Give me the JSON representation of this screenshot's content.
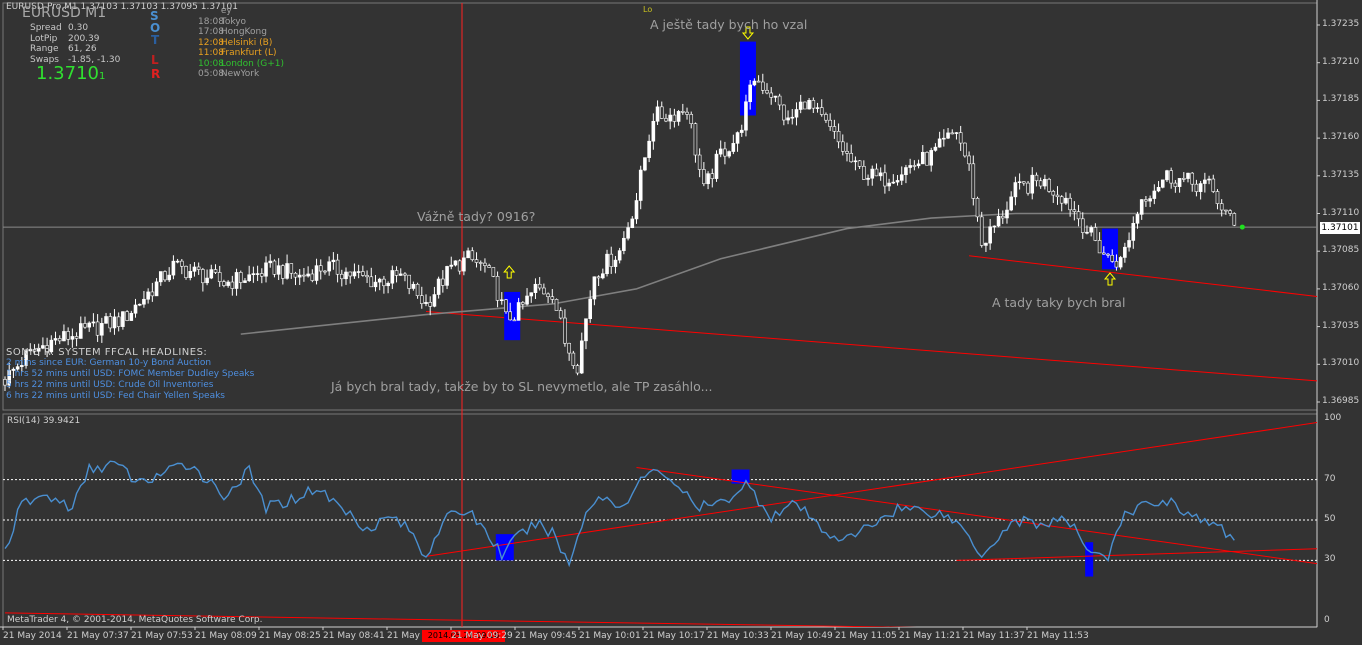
{
  "window": {
    "title": "EURUSD-Pro,M1  1.37103 1.37103 1.37095 1.37101",
    "symbol_big": "EURUSD    M1",
    "bg": "#333333"
  },
  "info_panel": {
    "rows": [
      {
        "label": "Spread",
        "value": "0.30"
      },
      {
        "label": "LotPip",
        "value": "200.39"
      },
      {
        "label": "Range",
        "value": "61, 26"
      },
      {
        "label": "Swaps",
        "value": "-1.85, -1.30"
      }
    ],
    "price": "1.3710",
    "price_digit": "1",
    "icons": [
      "S",
      "O",
      "T",
      "L",
      "R"
    ]
  },
  "sessions": [
    {
      "time": "",
      "name": "ey",
      "color": "#a0a0a0"
    },
    {
      "time": "18:08",
      "name": "Tokyo",
      "color": "#a0a0a0"
    },
    {
      "time": "17:08",
      "name": "HongKong",
      "color": "#a0a0a0"
    },
    {
      "time": "12:08",
      "name": "Helsinki  (B)",
      "color": "#e8a020"
    },
    {
      "time": "11:08",
      "name": "Frankfurt  (L)",
      "color": "#e8a020"
    },
    {
      "time": "10:08",
      "name": "London  (G+1)",
      "color": "#30c030"
    },
    {
      "time": "05:08",
      "name": "NewYork",
      "color": "#a0a0a0"
    }
  ],
  "news": {
    "headline": "SONIC R. SYSTEM  FFCAL HEADLINES:",
    "items": [
      "2 mins since EUR: German 10-y Bond Auction",
      "1 hrs 52 mins until USD: FOMC Member Dudley Speaks",
      "5 hrs 22 mins until USD: Crude Oil Inventories",
      "6 hrs 22 mins until USD: Fed Chair Yellen Speaks"
    ]
  },
  "annotations": {
    "top": "A ještě tady bych ho vzal",
    "mid": "Vážně tady? 0916?",
    "right": "A tady taky bych bral",
    "bottom": "Já bych bral tady, takže by to SL nevymetlo, ale TP zasáhlo...",
    "lo": "Lo"
  },
  "footer": {
    "copyright": "MetaTrader 4, © 2001-2014, MetaQuotes Software Corp.",
    "cursor_time": "2014.05.21 09:16",
    "current_price": "1.37101"
  },
  "colors": {
    "candle_up": "#ffffff",
    "candle_down": "#333333",
    "ma": "#7f7f7f",
    "trend": "#ff0000",
    "rsi": "#4a8fd0",
    "signal_box": "#0000ff",
    "arrow": "#ffff00",
    "axis": "#d0d0d0"
  },
  "chart_data": [
    {
      "type": "candlestick",
      "title": "EURUSD-Pro,M1",
      "y_tick_labels": [
        "1.37235",
        "1.37210",
        "1.37185",
        "1.37160",
        "1.37135",
        "1.37110",
        "1.37085",
        "1.37060",
        "1.37035",
        "1.37010",
        "1.36985"
      ],
      "ylim": [
        1.3698,
        1.3724
      ],
      "x_tick_labels": [
        "21 May 2014",
        "21 May 07:37",
        "21 May 07:53",
        "21 May 08:09",
        "21 May 08:25",
        "21 May 08:41",
        "21 May",
        "21 May 09:29",
        "21 May 09:45",
        "21 May 10:01",
        "21 May 10:17",
        "21 May 10:33",
        "21 May 10:49",
        "21 May 11:05",
        "21 May 11:21",
        "21 May 11:37",
        "21 May 11:53"
      ],
      "anchors": [
        {
          "bar": 0,
          "price": 1.37
        },
        {
          "bar": 5,
          "price": 1.37015
        },
        {
          "bar": 10,
          "price": 1.37024
        },
        {
          "bar": 20,
          "price": 1.37033
        },
        {
          "bar": 28,
          "price": 1.3704
        },
        {
          "bar": 35,
          "price": 1.3706
        },
        {
          "bar": 40,
          "price": 1.37075
        },
        {
          "bar": 46,
          "price": 1.3707
        },
        {
          "bar": 52,
          "price": 1.37064
        },
        {
          "bar": 58,
          "price": 1.37068
        },
        {
          "bar": 64,
          "price": 1.37074
        },
        {
          "bar": 70,
          "price": 1.37068
        },
        {
          "bar": 76,
          "price": 1.37075
        },
        {
          "bar": 82,
          "price": 1.3707
        },
        {
          "bar": 88,
          "price": 1.37065
        },
        {
          "bar": 94,
          "price": 1.37068
        },
        {
          "bar": 100,
          "price": 1.3705
        },
        {
          "bar": 106,
          "price": 1.37074
        },
        {
          "bar": 110,
          "price": 1.3708
        },
        {
          "bar": 114,
          "price": 1.37074
        },
        {
          "bar": 117,
          "price": 1.37058
        },
        {
          "bar": 119,
          "price": 1.3704
        },
        {
          "bar": 122,
          "price": 1.37045
        },
        {
          "bar": 126,
          "price": 1.3706
        },
        {
          "bar": 130,
          "price": 1.37058
        },
        {
          "bar": 133,
          "price": 1.37025
        },
        {
          "bar": 136,
          "price": 1.3701
        },
        {
          "bar": 140,
          "price": 1.3707
        },
        {
          "bar": 146,
          "price": 1.37085
        },
        {
          "bar": 150,
          "price": 1.3712
        },
        {
          "bar": 154,
          "price": 1.37175
        },
        {
          "bar": 158,
          "price": 1.37175
        },
        {
          "bar": 162,
          "price": 1.3718
        },
        {
          "bar": 166,
          "price": 1.37125
        },
        {
          "bar": 170,
          "price": 1.3715
        },
        {
          "bar": 174,
          "price": 1.3716
        },
        {
          "bar": 178,
          "price": 1.372
        },
        {
          "bar": 182,
          "price": 1.3719
        },
        {
          "bar": 186,
          "price": 1.3717
        },
        {
          "bar": 190,
          "price": 1.37185
        },
        {
          "bar": 196,
          "price": 1.37165
        },
        {
          "bar": 202,
          "price": 1.3714
        },
        {
          "bar": 208,
          "price": 1.37132
        },
        {
          "bar": 214,
          "price": 1.3714
        },
        {
          "bar": 220,
          "price": 1.37148
        },
        {
          "bar": 226,
          "price": 1.37165
        },
        {
          "bar": 229,
          "price": 1.3714
        },
        {
          "bar": 232,
          "price": 1.3709
        },
        {
          "bar": 236,
          "price": 1.37105
        },
        {
          "bar": 240,
          "price": 1.37125
        },
        {
          "bar": 246,
          "price": 1.37132
        },
        {
          "bar": 252,
          "price": 1.3712
        },
        {
          "bar": 258,
          "price": 1.37095
        },
        {
          "bar": 262,
          "price": 1.3708
        },
        {
          "bar": 265,
          "price": 1.37078
        },
        {
          "bar": 270,
          "price": 1.3712
        },
        {
          "bar": 276,
          "price": 1.37135
        },
        {
          "bar": 282,
          "price": 1.3713
        },
        {
          "bar": 286,
          "price": 1.37128
        },
        {
          "bar": 292,
          "price": 1.37101
        }
      ],
      "moving_average": [
        {
          "bar": 56,
          "price": 1.3703
        },
        {
          "bar": 100,
          "price": 1.37043
        },
        {
          "bar": 130,
          "price": 1.3705
        },
        {
          "bar": 150,
          "price": 1.3706
        },
        {
          "bar": 170,
          "price": 1.3708
        },
        {
          "bar": 200,
          "price": 1.371
        },
        {
          "bar": 220,
          "price": 1.37107
        },
        {
          "bar": 240,
          "price": 1.3711
        },
        {
          "bar": 290,
          "price": 1.3711
        }
      ],
      "current_price": 1.37101,
      "signals": [
        {
          "bar": 120,
          "type": "buy",
          "top": 1.37058,
          "bottom": 1.37026
        },
        {
          "bar": 176,
          "type": "sell",
          "top": 1.37224,
          "bottom": 1.37175
        },
        {
          "bar": 262,
          "type": "buy",
          "top": 1.371,
          "bottom": 1.37073
        }
      ],
      "trendlines": [
        {
          "from": {
            "bar": 100,
            "price": 1.37045
          },
          "to": {
            "bar": 330,
            "price": 1.36995
          }
        },
        {
          "from": {
            "bar": 229,
            "price": 1.37082
          },
          "to": {
            "bar": 330,
            "price": 1.37049
          }
        }
      ]
    },
    {
      "type": "line",
      "title": "RSI(14) 39.9421",
      "series": [
        {
          "name": "RSI(14)",
          "last": 39.9421
        }
      ],
      "ylim": [
        0,
        100
      ],
      "y_tick_labels": [
        "100",
        "70",
        "50",
        "30",
        "0"
      ],
      "levels": [
        70,
        50,
        30
      ],
      "anchors": [
        {
          "bar": 0,
          "value": 35
        },
        {
          "bar": 4,
          "value": 58
        },
        {
          "bar": 10,
          "value": 62
        },
        {
          "bar": 16,
          "value": 56
        },
        {
          "bar": 20,
          "value": 75
        },
        {
          "bar": 26,
          "value": 78
        },
        {
          "bar": 32,
          "value": 68
        },
        {
          "bar": 36,
          "value": 72
        },
        {
          "bar": 44,
          "value": 78
        },
        {
          "bar": 52,
          "value": 62
        },
        {
          "bar": 58,
          "value": 74
        },
        {
          "bar": 62,
          "value": 56
        },
        {
          "bar": 68,
          "value": 60
        },
        {
          "bar": 74,
          "value": 66
        },
        {
          "bar": 80,
          "value": 56
        },
        {
          "bar": 86,
          "value": 46
        },
        {
          "bar": 92,
          "value": 52
        },
        {
          "bar": 96,
          "value": 45
        },
        {
          "bar": 100,
          "value": 32
        },
        {
          "bar": 104,
          "value": 50
        },
        {
          "bar": 110,
          "value": 55
        },
        {
          "bar": 114,
          "value": 45
        },
        {
          "bar": 118,
          "value": 33
        },
        {
          "bar": 122,
          "value": 42
        },
        {
          "bar": 126,
          "value": 48
        },
        {
          "bar": 130,
          "value": 44
        },
        {
          "bar": 134,
          "value": 28
        },
        {
          "bar": 138,
          "value": 55
        },
        {
          "bar": 142,
          "value": 62
        },
        {
          "bar": 146,
          "value": 56
        },
        {
          "bar": 152,
          "value": 72
        },
        {
          "bar": 156,
          "value": 74
        },
        {
          "bar": 160,
          "value": 67
        },
        {
          "bar": 164,
          "value": 56
        },
        {
          "bar": 170,
          "value": 58
        },
        {
          "bar": 176,
          "value": 68
        },
        {
          "bar": 182,
          "value": 52
        },
        {
          "bar": 188,
          "value": 58
        },
        {
          "bar": 194,
          "value": 45
        },
        {
          "bar": 200,
          "value": 40
        },
        {
          "bar": 206,
          "value": 48
        },
        {
          "bar": 212,
          "value": 56
        },
        {
          "bar": 218,
          "value": 55
        },
        {
          "bar": 224,
          "value": 52
        },
        {
          "bar": 228,
          "value": 45
        },
        {
          "bar": 232,
          "value": 33
        },
        {
          "bar": 236,
          "value": 42
        },
        {
          "bar": 240,
          "value": 50
        },
        {
          "bar": 246,
          "value": 48
        },
        {
          "bar": 252,
          "value": 50
        },
        {
          "bar": 258,
          "value": 35
        },
        {
          "bar": 262,
          "value": 32
        },
        {
          "bar": 266,
          "value": 52
        },
        {
          "bar": 270,
          "value": 57
        },
        {
          "bar": 276,
          "value": 60
        },
        {
          "bar": 282,
          "value": 52
        },
        {
          "bar": 286,
          "value": 48
        },
        {
          "bar": 290,
          "value": 44
        },
        {
          "bar": 292,
          "value": 39.9421
        }
      ],
      "signals": [
        {
          "bar": 118,
          "top": 43,
          "bottom": 30
        },
        {
          "bar": 174,
          "top": 75,
          "bottom": 68
        },
        {
          "bar": 258,
          "top": 39,
          "bottom": 22
        }
      ],
      "trendlines": [
        {
          "from": {
            "bar": 100,
            "value": 32
          },
          "to": {
            "bar": 330,
            "value": 104
          }
        },
        {
          "from": {
            "bar": 150,
            "value": 76
          },
          "to": {
            "bar": 330,
            "value": 23
          }
        },
        {
          "from": {
            "bar": 226,
            "value": 30
          },
          "to": {
            "bar": 330,
            "value": 37
          }
        },
        {
          "from": {
            "bar": 0,
            "value": 4
          },
          "to": {
            "bar": 330,
            "value": -7
          }
        }
      ]
    }
  ]
}
